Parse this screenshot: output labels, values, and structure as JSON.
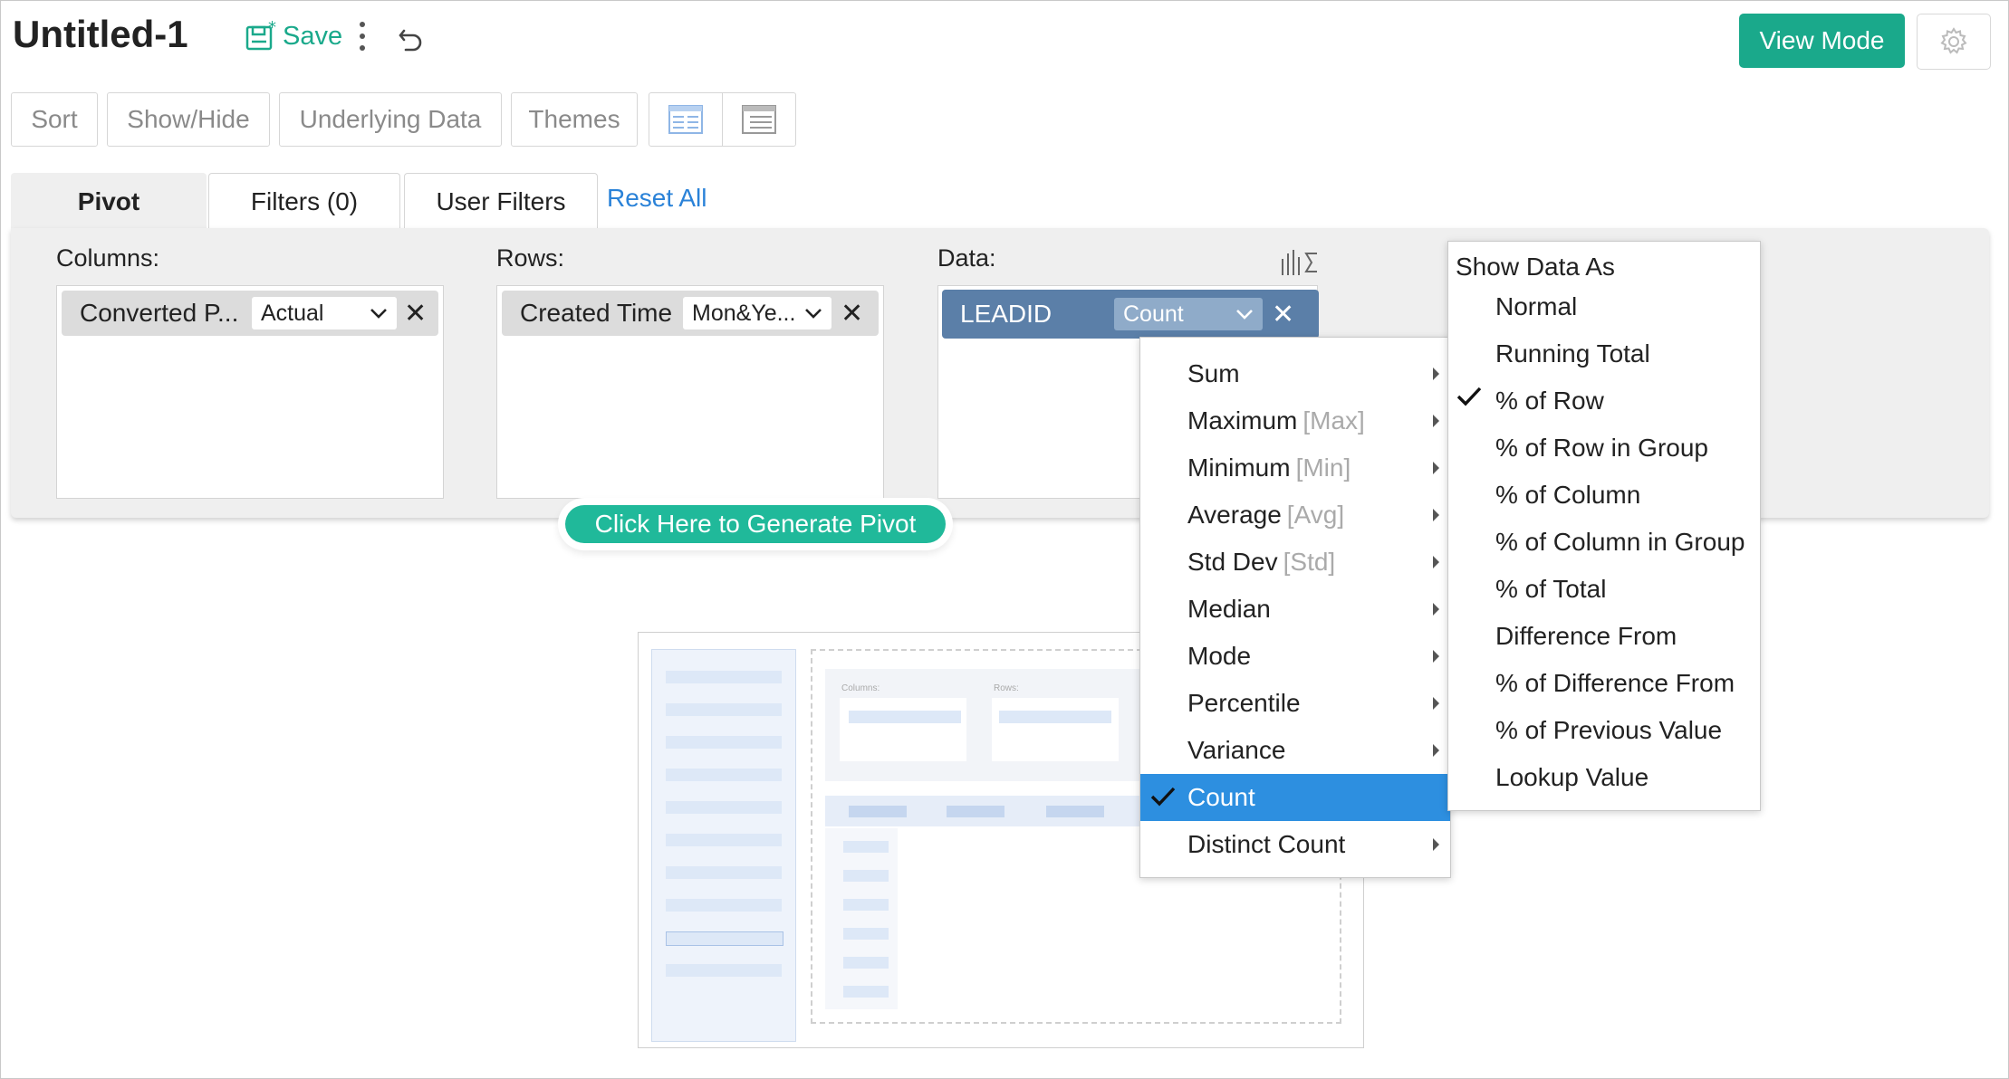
{
  "header": {
    "title": "Untitled-1",
    "save_label": "Save",
    "view_mode_label": "View Mode",
    "accent": "#1aa98b"
  },
  "toolbar": {
    "sort": "Sort",
    "show_hide": "Show/Hide",
    "underlying_data": "Underlying Data",
    "themes": "Themes"
  },
  "tabs": [
    {
      "label": "Pivot",
      "active": true
    },
    {
      "label": "Filters  (0)",
      "active": false
    },
    {
      "label": "User Filters",
      "active": false
    }
  ],
  "reset_all": "Reset All",
  "pivot": {
    "columns_label": "Columns:",
    "rows_label": "Rows:",
    "data_label": "Data:",
    "columns_chip": {
      "name": "Converted P...",
      "option": "Actual"
    },
    "rows_chip": {
      "name": "Created Time",
      "option": "Mon&Ye..."
    },
    "data_chip": {
      "name": "LEADID",
      "option": "Count"
    },
    "generate_label": "Click Here to Generate Pivot"
  },
  "illustration": {
    "columns_label": "Columns:",
    "rows_label": "Rows:"
  },
  "aggregate_menu": {
    "items": [
      {
        "label": "Sum",
        "hint": "",
        "submenu": true
      },
      {
        "label": "Maximum",
        "hint": "[Max]",
        "submenu": true
      },
      {
        "label": "Minimum",
        "hint": "[Min]",
        "submenu": true
      },
      {
        "label": "Average",
        "hint": "[Avg]",
        "submenu": true
      },
      {
        "label": "Std Dev",
        "hint": "[Std]",
        "submenu": true
      },
      {
        "label": "Median",
        "hint": "",
        "submenu": true
      },
      {
        "label": "Mode",
        "hint": "",
        "submenu": true
      },
      {
        "label": "Percentile",
        "hint": "",
        "submenu": true
      },
      {
        "label": "Variance",
        "hint": "",
        "submenu": true
      },
      {
        "label": "Count",
        "hint": "",
        "submenu": false,
        "selected": true
      },
      {
        "label": "Distinct Count",
        "hint": "",
        "submenu": true
      }
    ],
    "selected_color": "#2d8fe0"
  },
  "show_data_as_menu": {
    "heading": "Show Data As",
    "items": [
      {
        "label": "Normal",
        "checked": false
      },
      {
        "label": "Running Total",
        "checked": false
      },
      {
        "label": "% of Row",
        "checked": true
      },
      {
        "label": "% of Row in Group",
        "checked": false
      },
      {
        "label": "% of Column",
        "checked": false
      },
      {
        "label": "% of Column in Group",
        "checked": false
      },
      {
        "label": "% of Total",
        "checked": false
      },
      {
        "label": "Difference From",
        "checked": false
      },
      {
        "label": "% of Difference From",
        "checked": false
      },
      {
        "label": "% of Previous Value",
        "checked": false
      },
      {
        "label": "Lookup Value",
        "checked": false
      }
    ]
  }
}
